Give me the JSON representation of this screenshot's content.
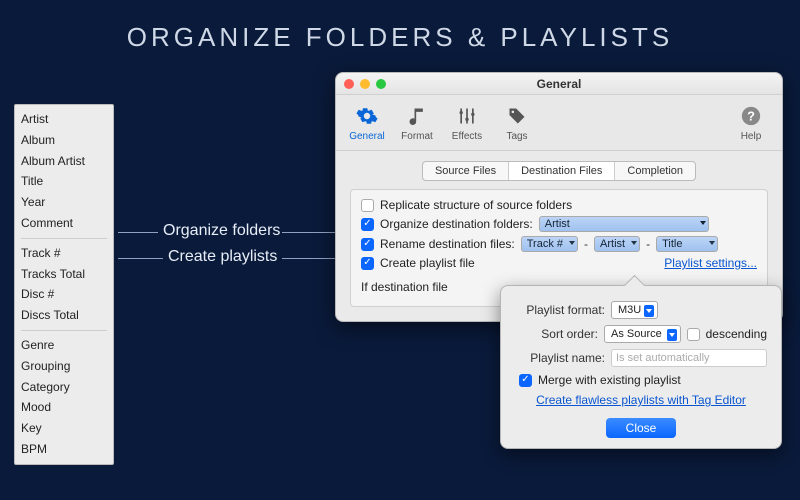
{
  "headline": "ORGANIZE FOLDERS & PLAYLISTS",
  "taglist": {
    "groups": [
      [
        "Artist",
        "Album",
        "Album Artist",
        "Title",
        "Year",
        "Comment"
      ],
      [
        "Track #",
        "Tracks Total",
        "Disc #",
        "Discs Total"
      ],
      [
        "Genre",
        "Grouping",
        "Category",
        "Mood",
        "Key",
        "BPM"
      ]
    ]
  },
  "connectors": {
    "organize": "Organize folders",
    "playlists": "Create  playlists"
  },
  "window": {
    "title": "General",
    "toolbar": {
      "general": "General",
      "format": "Format",
      "effects": "Effects",
      "tags": "Tags",
      "help": "Help"
    },
    "subtabs": {
      "source": "Source Files",
      "dest": "Destination Files",
      "completion": "Completion"
    },
    "panel": {
      "replicate": "Replicate structure of source folders",
      "organize": "Organize destination folders:",
      "organize_token": "Artist",
      "rename": "Rename destination files:",
      "rename_tokens": [
        "Track #",
        "Artist",
        "Title"
      ],
      "create_pl": "Create playlist file",
      "pl_settings": "Playlist settings...",
      "if_dest": "If destination file"
    }
  },
  "popover": {
    "format_lbl": "Playlist format:",
    "format_val": "M3U",
    "sort_lbl": "Sort order:",
    "sort_val": "As Source",
    "descending": "descending",
    "name_lbl": "Playlist name:",
    "name_placeholder": "Is set automatically",
    "merge": "Merge with existing playlist",
    "taglink": "Create flawless playlists with Tag Editor",
    "close": "Close"
  }
}
